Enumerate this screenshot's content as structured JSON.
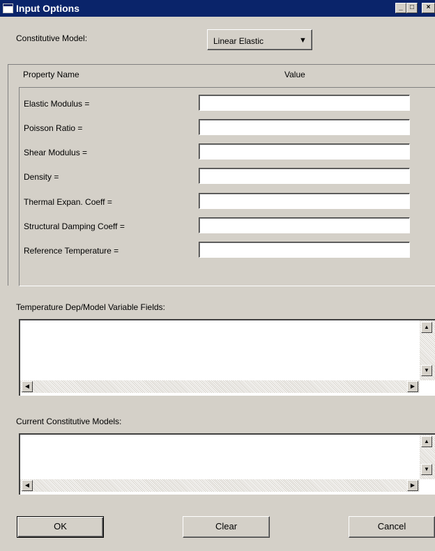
{
  "window": {
    "title": "Input Options"
  },
  "model": {
    "label": "Constitutive Model:",
    "selected": "Linear Elastic"
  },
  "properties": {
    "header_name": "Property Name",
    "header_value": "Value",
    "items": [
      {
        "label": "Elastic Modulus =",
        "value": ""
      },
      {
        "label": "Poisson Ratio =",
        "value": ""
      },
      {
        "label": "Shear Modulus =",
        "value": ""
      },
      {
        "label": "Density =",
        "value": ""
      },
      {
        "label": "Thermal Expan. Coeff =",
        "value": ""
      },
      {
        "label": "Structural Damping Coeff =",
        "value": ""
      },
      {
        "label": "Reference Temperature =",
        "value": ""
      }
    ]
  },
  "temp_fields": {
    "label": "Temperature Dep/Model Variable Fields:"
  },
  "current_models": {
    "label": "Current Constitutive Models:"
  },
  "buttons": {
    "ok": "OK",
    "clear": "Clear",
    "cancel": "Cancel"
  }
}
